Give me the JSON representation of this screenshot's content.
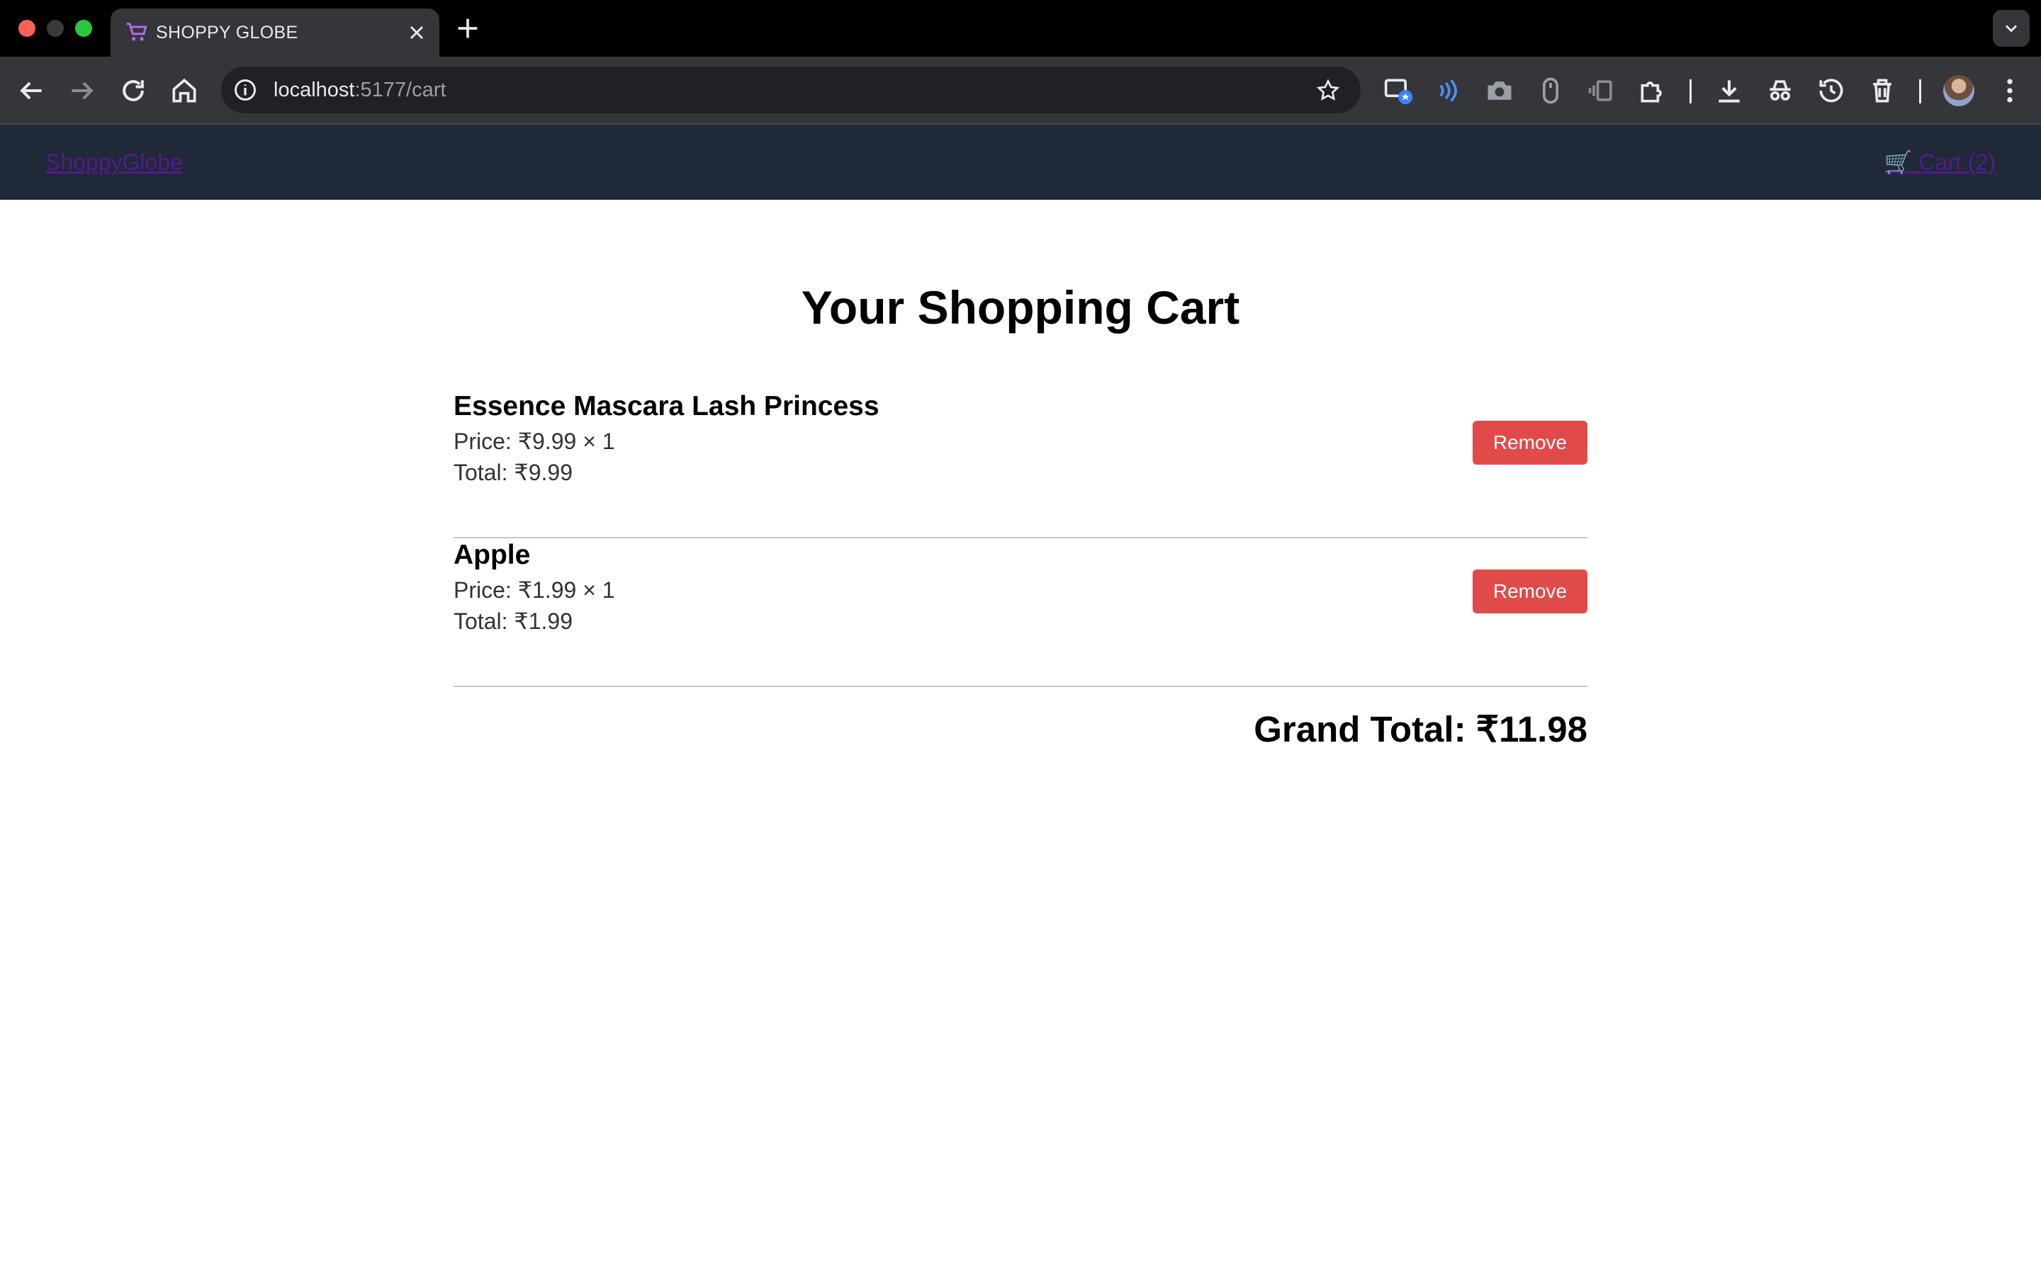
{
  "browser": {
    "tab_title": "SHOPPY GLOBE",
    "url_host": "localhost",
    "url_path": ":5177/cart"
  },
  "site": {
    "brand": "ShoppyGlobe",
    "cart_link": "🛒 Cart (2)"
  },
  "cart": {
    "title": "Your Shopping Cart",
    "items": [
      {
        "name": "Essence Mascara Lash Princess",
        "price": "Price: ₹9.99 × 1",
        "total": "Total: ₹9.99",
        "remove_label": "Remove"
      },
      {
        "name": "Apple",
        "price": "Price: ₹1.99 × 1",
        "total": "Total: ₹1.99",
        "remove_label": "Remove"
      }
    ],
    "grand_total": "Grand Total: ₹11.98"
  },
  "colors": {
    "nav_bg": "#1f2937",
    "link": "#551a8b",
    "remove_button": "#e04a48"
  }
}
